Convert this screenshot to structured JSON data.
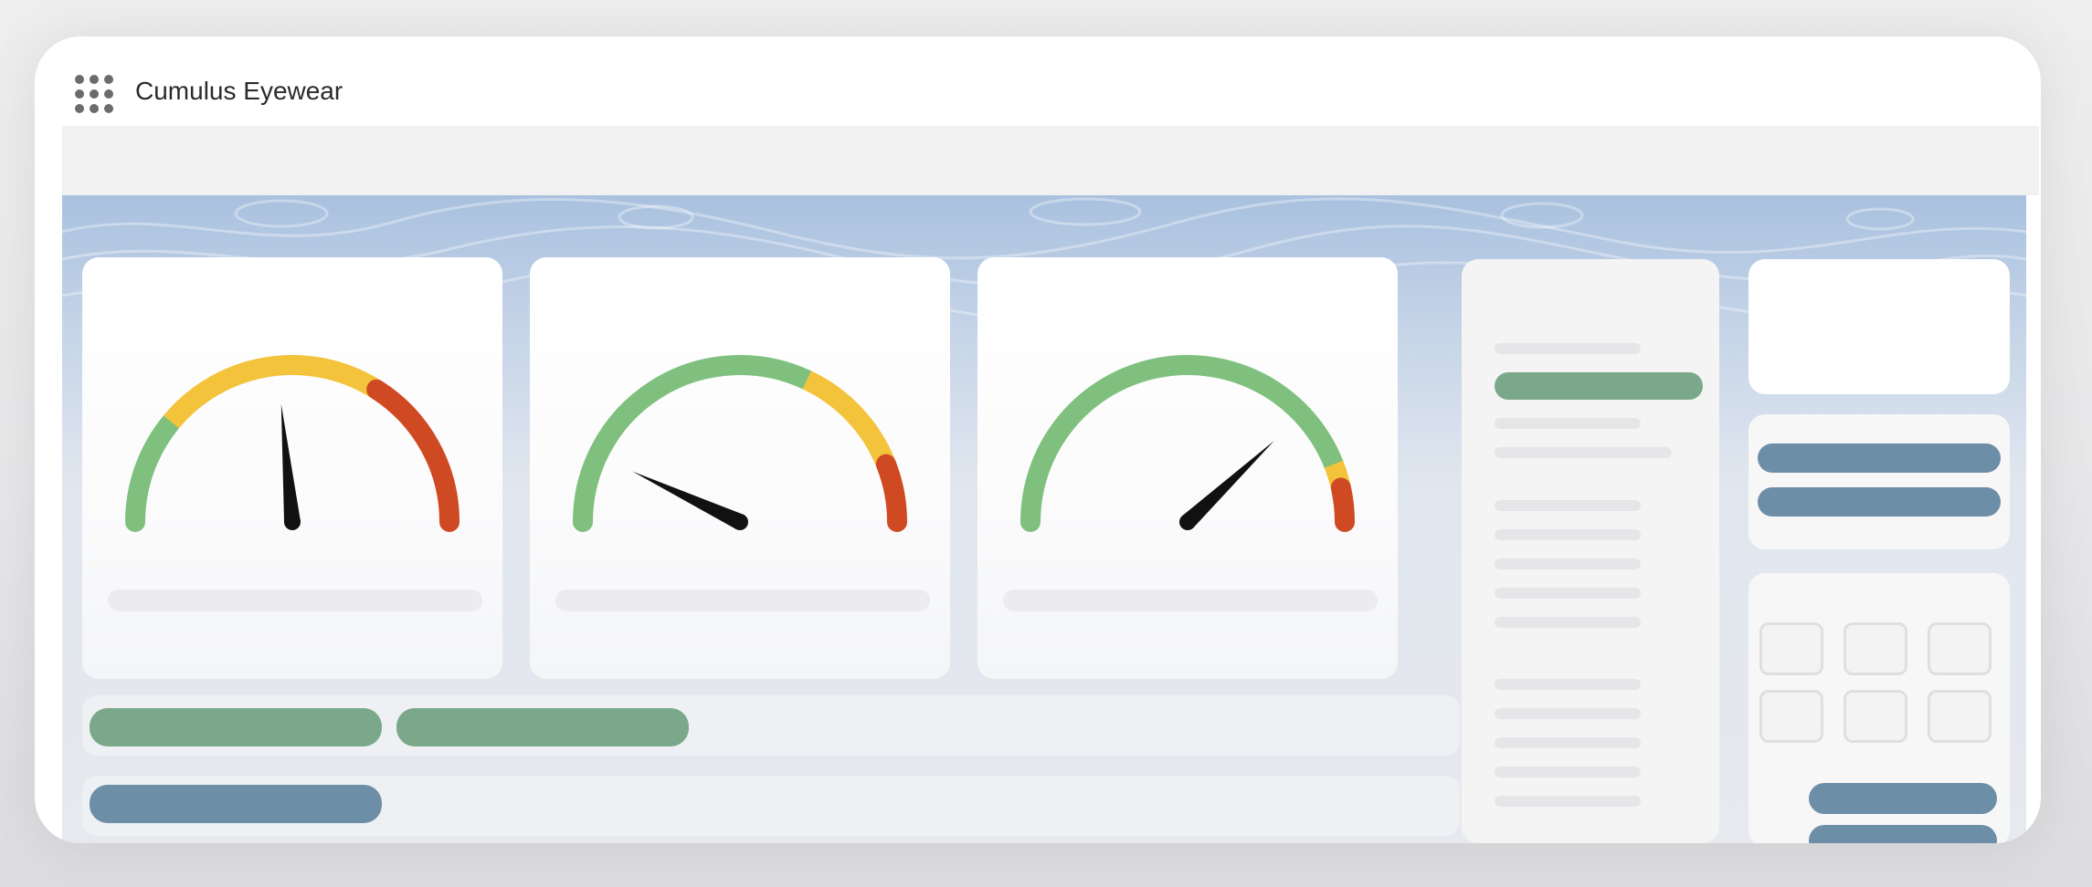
{
  "app": {
    "title": "Cumulus Eyewear"
  },
  "icons": {
    "launcher": "app-launcher-grid-icon"
  },
  "colors": {
    "gauge_green": "#7fc07e",
    "gauge_yellow": "#f3c33c",
    "gauge_red": "#cf4a22",
    "pill_green": "#7ba88a",
    "pill_blue": "#6d8ea7"
  },
  "gauges": [
    {
      "needle_fraction": 0.47,
      "zones": [
        {
          "color": "green",
          "to": 0.22
        },
        {
          "color": "yellow",
          "to": 0.68
        },
        {
          "color": "red",
          "to": 1.0
        }
      ]
    },
    {
      "needle_fraction": 0.14,
      "zones": [
        {
          "color": "green",
          "to": 0.64
        },
        {
          "color": "yellow",
          "to": 0.88
        },
        {
          "color": "red",
          "to": 1.0
        }
      ]
    },
    {
      "needle_fraction": 0.76,
      "zones": [
        {
          "color": "green",
          "to": 0.88
        },
        {
          "color": "yellow",
          "to": 0.93
        },
        {
          "color": "red",
          "to": 1.0
        }
      ]
    }
  ]
}
